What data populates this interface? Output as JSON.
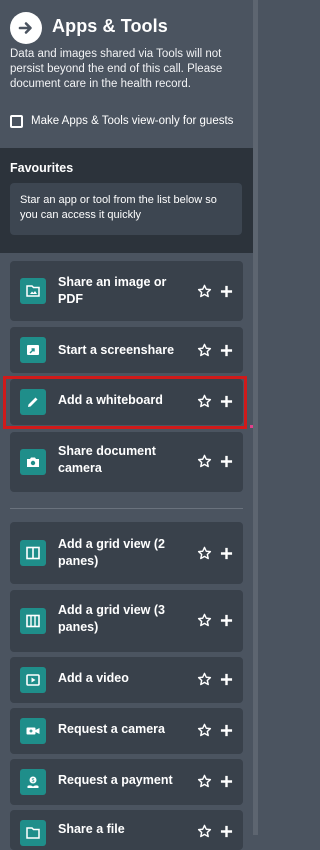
{
  "header": {
    "title": "Apps & Tools",
    "notice": "Data and images shared via Tools will not persist beyond the end of this call. Please document care in the health record.",
    "guest_option": {
      "label": "Make Apps & Tools view-only for guests",
      "checked": false
    }
  },
  "favourites": {
    "title": "Favourites",
    "empty_message": "Star an app or tool from the list below so you can access it quickly"
  },
  "tools": [
    {
      "label": "Share an image or PDF",
      "icon": "image-file-icon"
    },
    {
      "label": "Start a screenshare",
      "icon": "screenshare-icon"
    },
    {
      "label": "Add a whiteboard",
      "icon": "pencil-icon",
      "highlighted": true
    },
    {
      "label": "Share document camera",
      "icon": "camera-icon"
    }
  ],
  "more_tools": [
    {
      "label": "Add a grid view (2 panes)",
      "icon": "grid-2-icon"
    },
    {
      "label": "Add a grid view (3 panes)",
      "icon": "grid-3-icon"
    },
    {
      "label": "Add a video",
      "icon": "video-play-icon"
    },
    {
      "label": "Request a camera",
      "icon": "video-camera-icon"
    },
    {
      "label": "Request a payment",
      "icon": "payment-icon"
    },
    {
      "label": "Share a file",
      "icon": "file-icon"
    }
  ],
  "colors": {
    "panel_bg": "#4b5460",
    "favourites_bg": "#2c333b",
    "card_bg": "#39414b",
    "accent": "#1f8e8a",
    "highlight": "#d01a1a"
  }
}
